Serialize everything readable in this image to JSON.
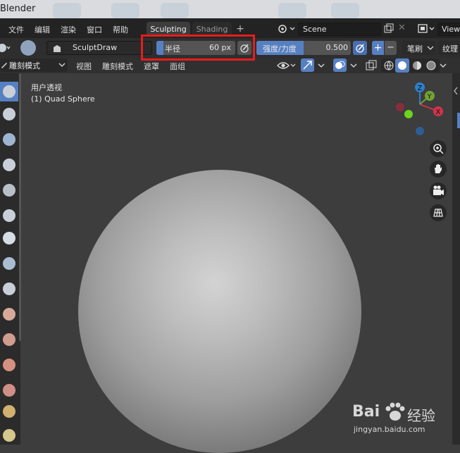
{
  "window": {
    "title": "Blender"
  },
  "menubar": {
    "items": [
      "文件",
      "编辑",
      "渲染",
      "窗口",
      "帮助"
    ],
    "workspaces": [
      "Sculpting",
      "Shading"
    ],
    "add_tab": "+",
    "scene_name": "Scene",
    "view_layer_label": "View"
  },
  "toolsettings": {
    "brush_name": "SculptDraw",
    "radius": {
      "label": "半径",
      "value": "60 px"
    },
    "strength": {
      "label": "强度/力度",
      "value": "0.500",
      "fill_fraction": 0.5
    },
    "plus": "+",
    "minus": "−",
    "stroke_label": "笔刷",
    "texture_label": "纹理"
  },
  "viewport_header": {
    "mode": "雕刻模式",
    "menus": [
      "视图",
      "雕刻模式",
      "遮罩",
      "面组"
    ]
  },
  "viewport": {
    "view_name": "用户透视",
    "object_name": "(1) Quad Sphere",
    "gizmo_labels": {
      "x": "X",
      "y": "Y",
      "z": "Z"
    }
  },
  "watermark": {
    "brand": "Bai",
    "brand2": "经验",
    "url": "jingyan.baidu.com"
  },
  "colors": {
    "accent": "#5680c2",
    "highlight": "#e81c1c"
  }
}
